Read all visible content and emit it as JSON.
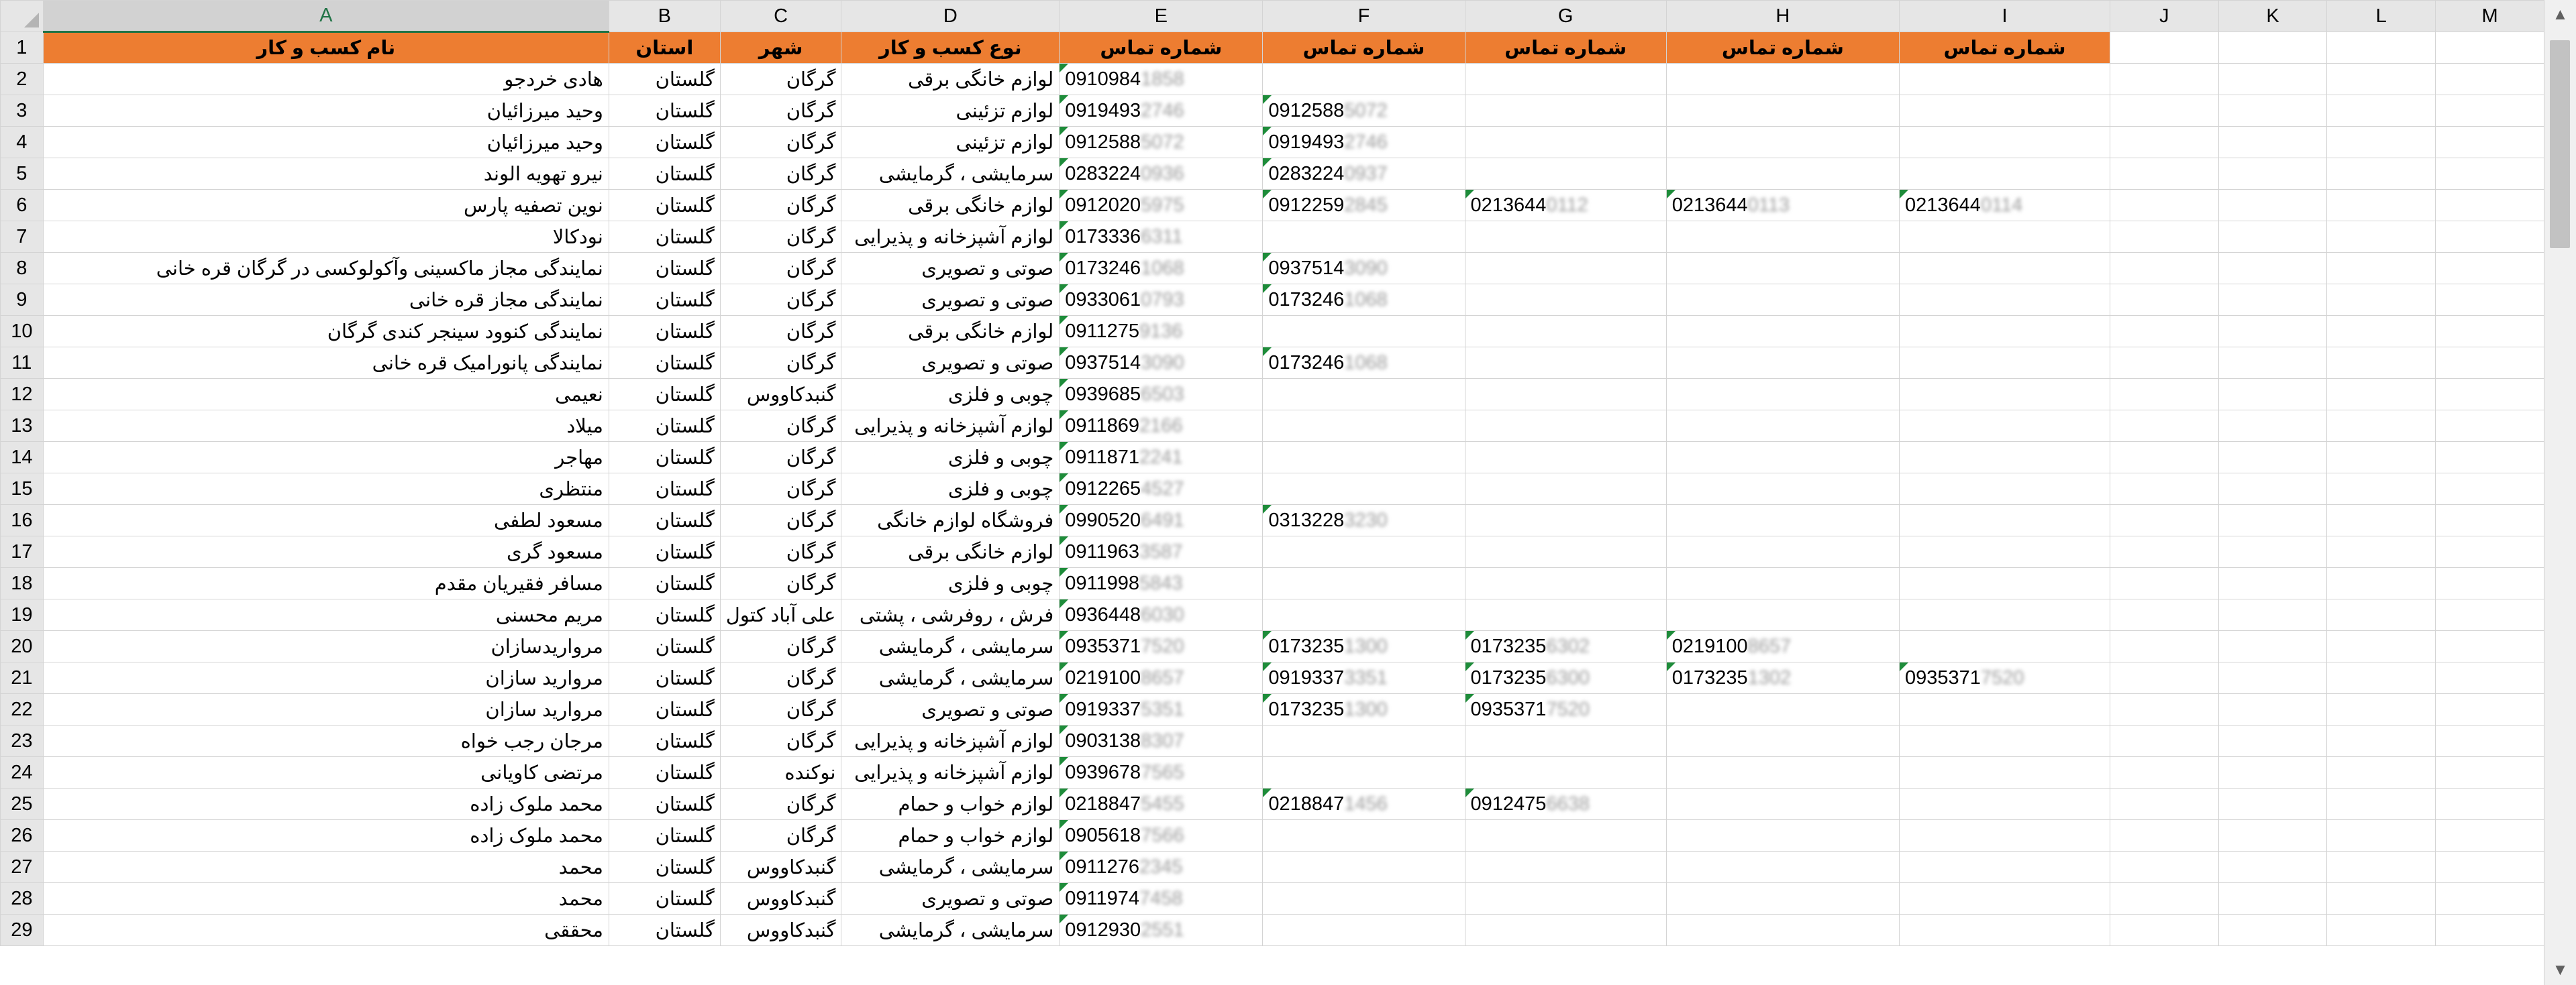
{
  "columns": [
    "A",
    "B",
    "C",
    "D",
    "E",
    "F",
    "G",
    "H",
    "I",
    "J",
    "K",
    "L",
    "M"
  ],
  "selected_column": "A",
  "header": [
    "نام کسب و کار",
    "استان",
    "شهر",
    "نوع کسب و کار",
    "شماره تماس",
    "شماره تماس",
    "شماره تماس",
    "شماره تماس",
    "شماره تماس"
  ],
  "rows": [
    {
      "n": "2",
      "a": "هادی خردجو",
      "b": "گلستان",
      "c": "گرگان",
      "d": "لوازم خانگی برقی",
      "phones": [
        [
          "0910984",
          "1858"
        ]
      ]
    },
    {
      "n": "3",
      "a": "وحید میرزائیان",
      "b": "گلستان",
      "c": "گرگان",
      "d": "لوازم تزئینی",
      "phones": [
        [
          "0919493",
          "2746"
        ],
        [
          "0912588",
          "5072"
        ]
      ]
    },
    {
      "n": "4",
      "a": "وحید میرزائیان",
      "b": "گلستان",
      "c": "گرگان",
      "d": "لوازم تزئینی",
      "phones": [
        [
          "0912588",
          "5072"
        ],
        [
          "0919493",
          "2746"
        ]
      ]
    },
    {
      "n": "5",
      "a": "نیرو تهویه الوند",
      "b": "گلستان",
      "c": "گرگان",
      "d": "سرمایشی ، گرمایشی",
      "phones": [
        [
          "0283224",
          "0936"
        ],
        [
          "0283224",
          "0937"
        ]
      ]
    },
    {
      "n": "6",
      "a": "نوین تصفیه پارس",
      "b": "گلستان",
      "c": "گرگان",
      "d": "لوازم خانگی برقی",
      "phones": [
        [
          "0912020",
          "5975"
        ],
        [
          "0912259",
          "2845"
        ],
        [
          "0213644",
          "0112"
        ],
        [
          "0213644",
          "0113"
        ],
        [
          "0213644",
          "0114"
        ]
      ]
    },
    {
      "n": "7",
      "a": "نودکالا",
      "b": "گلستان",
      "c": "گرگان",
      "d": "لوازم آشپزخانه و پذیرایی",
      "phones": [
        [
          "0173336",
          "6311"
        ]
      ]
    },
    {
      "n": "8",
      "a": "نمایندگی مجاز ماکسینی وآکولوکسی در گرگان قره خانی",
      "b": "گلستان",
      "c": "گرگان",
      "d": "صوتی و تصویری",
      "phones": [
        [
          "0173246",
          "1068"
        ],
        [
          "0937514",
          "3090"
        ]
      ]
    },
    {
      "n": "9",
      "a": "نمایندگی مجاز قره خانی",
      "b": "گلستان",
      "c": "گرگان",
      "d": "صوتی و تصویری",
      "phones": [
        [
          "0933061",
          "0793"
        ],
        [
          "0173246",
          "1068"
        ]
      ]
    },
    {
      "n": "10",
      "a": "نمایندگی کنوود سینجر کندی گرگان",
      "b": "گلستان",
      "c": "گرگان",
      "d": "لوازم خانگی برقی",
      "phones": [
        [
          "0911275",
          "9136"
        ]
      ]
    },
    {
      "n": "11",
      "a": "نمایندگی پانورامیک قره خانی",
      "b": "گلستان",
      "c": "گرگان",
      "d": "صوتی و تصویری",
      "phones": [
        [
          "0937514",
          "3090"
        ],
        [
          "0173246",
          "1068"
        ]
      ]
    },
    {
      "n": "12",
      "a": "نعیمی",
      "b": "گلستان",
      "c": "گنبدکاووس",
      "d": "چوبی و فلزی",
      "phones": [
        [
          "0939685",
          "6503"
        ]
      ]
    },
    {
      "n": "13",
      "a": "میلاد",
      "b": "گلستان",
      "c": "گرگان",
      "d": "لوازم آشپزخانه و پذیرایی",
      "phones": [
        [
          "0911869",
          "2166"
        ]
      ]
    },
    {
      "n": "14",
      "a": "مهاجر",
      "b": "گلستان",
      "c": "گرگان",
      "d": "چوبی و فلزی",
      "phones": [
        [
          "0911871",
          "2241"
        ]
      ]
    },
    {
      "n": "15",
      "a": "منتظری",
      "b": "گلستان",
      "c": "گرگان",
      "d": "چوبی و فلزی",
      "phones": [
        [
          "0912265",
          "4527"
        ]
      ]
    },
    {
      "n": "16",
      "a": "مسعود لطفی",
      "b": "گلستان",
      "c": "گرگان",
      "d": "فروشگاه لوازم خانگی",
      "phones": [
        [
          "0990520",
          "6491"
        ],
        [
          "0313228",
          "3230"
        ]
      ]
    },
    {
      "n": "17",
      "a": "مسعود گری",
      "b": "گلستان",
      "c": "گرگان",
      "d": "لوازم خانگی برقی",
      "phones": [
        [
          "0911963",
          "3587"
        ]
      ]
    },
    {
      "n": "18",
      "a": "مسافر فقیریان مقدم",
      "b": "گلستان",
      "c": "گرگان",
      "d": "چوبی و فلزی",
      "phones": [
        [
          "0911998",
          "5843"
        ]
      ]
    },
    {
      "n": "19",
      "a": "مریم محسنی",
      "b": "گلستان",
      "c": "علی آباد کتول",
      "d": "فرش ، روفرشی ، پشتی",
      "phones": [
        [
          "0936448",
          "6030"
        ]
      ]
    },
    {
      "n": "20",
      "a": "مرواریدسازان",
      "b": "گلستان",
      "c": "گرگان",
      "d": "سرمایشی ، گرمایشی",
      "phones": [
        [
          "0935371",
          "7520"
        ],
        [
          "0173235",
          "1300"
        ],
        [
          "0173235",
          "6302"
        ],
        [
          "0219100",
          "8657"
        ]
      ]
    },
    {
      "n": "21",
      "a": "مروارید سازان",
      "b": "گلستان",
      "c": "گرگان",
      "d": "سرمایشی ، گرمایشی",
      "phones": [
        [
          "0219100",
          "8657"
        ],
        [
          "0919337",
          "3351"
        ],
        [
          "0173235",
          "6300"
        ],
        [
          "0173235",
          "1302"
        ],
        [
          "0935371",
          "7520"
        ]
      ]
    },
    {
      "n": "22",
      "a": "مروارید سازان",
      "b": "گلستان",
      "c": "گرگان",
      "d": "صوتی و تصویری",
      "phones": [
        [
          "0919337",
          "5351"
        ],
        [
          "0173235",
          "1300"
        ],
        [
          "0935371",
          "7520"
        ]
      ]
    },
    {
      "n": "23",
      "a": "مرجان رجب خواه",
      "b": "گلستان",
      "c": "گرگان",
      "d": "لوازم آشپزخانه و پذیرایی",
      "phones": [
        [
          "0903138",
          "8307"
        ]
      ]
    },
    {
      "n": "24",
      "a": "مرتضی کاویانی",
      "b": "گلستان",
      "c": "نوکنده",
      "d": "لوازم آشپزخانه و پذیرایی",
      "phones": [
        [
          "0939678",
          "7565"
        ]
      ]
    },
    {
      "n": "25",
      "a": "محمد ملوک زاده",
      "b": "گلستان",
      "c": "گرگان",
      "d": "لوازم خواب و حمام",
      "phones": [
        [
          "0218847",
          "5455"
        ],
        [
          "0218847",
          "1456"
        ],
        [
          "0912475",
          "6638"
        ]
      ]
    },
    {
      "n": "26",
      "a": "محمد ملوک زاده",
      "b": "گلستان",
      "c": "گرگان",
      "d": "لوازم خواب و حمام",
      "phones": [
        [
          "0905618",
          "7566"
        ]
      ]
    },
    {
      "n": "27",
      "a": "محمد",
      "b": "گلستان",
      "c": "گنبدکاووس",
      "d": "سرمایشی ، گرمایشی",
      "phones": [
        [
          "0911276",
          "2345"
        ]
      ]
    },
    {
      "n": "28",
      "a": "محمد",
      "b": "گلستان",
      "c": "گنبدکاووس",
      "d": "صوتی و تصویری",
      "phones": [
        [
          "0911974",
          "7458"
        ]
      ]
    },
    {
      "n": "29",
      "a": "محققی",
      "b": "گلستان",
      "c": "گنبدکاووس",
      "d": "سرمایشی ، گرمایشی",
      "phones": [
        [
          "0912930",
          "2551"
        ]
      ]
    }
  ]
}
